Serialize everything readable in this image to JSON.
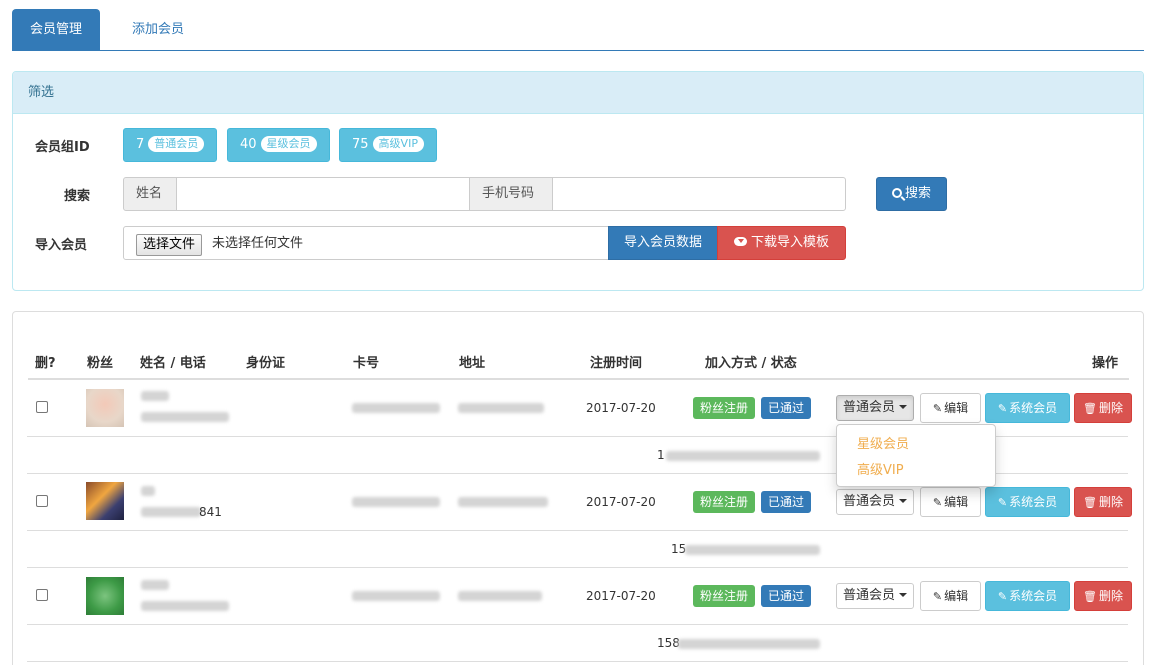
{
  "tabs": [
    {
      "label": "会员管理",
      "active": true
    },
    {
      "label": "添加会员",
      "active": false
    }
  ],
  "filter": {
    "heading": "筛选",
    "group_label": "会员组ID",
    "groups": [
      {
        "id": "7",
        "name": "普通会员"
      },
      {
        "id": "40",
        "name": "星级会员"
      },
      {
        "id": "75",
        "name": "高级VIP"
      }
    ],
    "search_label": "搜索",
    "name_addon": "姓名",
    "phone_addon": "手机号码",
    "search_button": "搜索",
    "import_label": "导入会员",
    "file_button": "选择文件",
    "file_status": "未选择任何文件",
    "import_button": "导入会员数据",
    "download_button": "下载导入模板"
  },
  "table": {
    "headers": [
      "删?",
      "粉丝",
      "姓名 / 电话",
      "身份证",
      "卡号",
      "地址",
      "注册时间",
      "加入方式 / 状态",
      "操作"
    ],
    "rows": [
      {
        "phone_partial": "",
        "date": "2017-07-20",
        "join": "粉丝注册",
        "status": "已通过",
        "group": "普通会员",
        "sub_prefix": "1"
      },
      {
        "phone_partial": "841",
        "date": "2017-07-20",
        "join": "粉丝注册",
        "status": "已通过",
        "group": "普通会员",
        "sub_prefix": "15"
      },
      {
        "phone_partial": "",
        "date": "2017-07-20",
        "join": "粉丝注册",
        "status": "已通过",
        "group": "普通会员",
        "sub_prefix": "158"
      }
    ],
    "edit_button": "编辑",
    "system_button": "系统会员",
    "delete_button": "删除"
  },
  "dropdown": {
    "items": [
      "星级会员",
      "高级VIP"
    ],
    "color": "#f0ad4e"
  },
  "colors": {
    "primary": "#337ab7",
    "info": "#5bc0de",
    "success": "#5cb85c",
    "danger": "#d9534f"
  }
}
